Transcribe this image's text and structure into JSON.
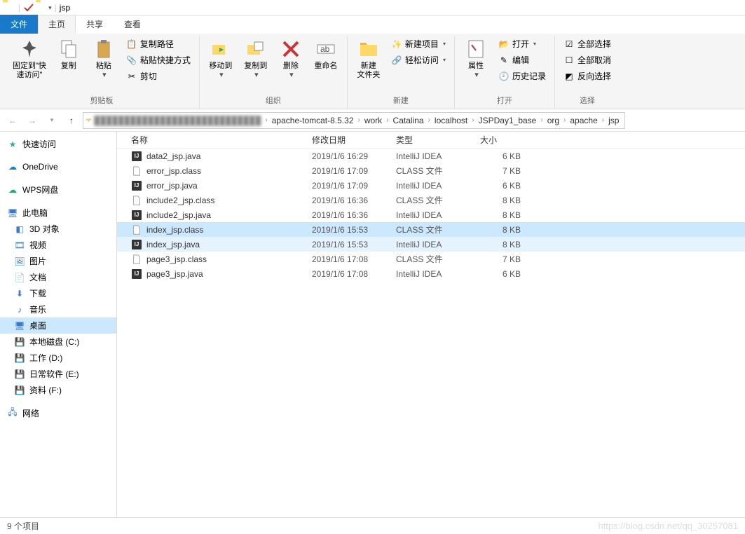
{
  "title": "jsp",
  "tabs": {
    "file": "文件",
    "home": "主页",
    "share": "共享",
    "view": "查看"
  },
  "ribbon": {
    "pin": "固定到\"快\n速访问\"",
    "copy": "复制",
    "paste": "粘贴",
    "cut": "剪切",
    "copypath": "复制路径",
    "pasteshortcut": "粘贴快捷方式",
    "group_clipboard": "剪贴板",
    "moveto": "移动到",
    "copyto": "复制到",
    "delete": "删除",
    "rename": "重命名",
    "group_organize": "组织",
    "newfolder": "新建\n文件夹",
    "newitem": "新建项目",
    "easyaccess": "轻松访问",
    "group_new": "新建",
    "properties": "属性",
    "open": "打开",
    "edit": "编辑",
    "history": "历史记录",
    "group_open": "打开",
    "selectall": "全部选择",
    "selectnone": "全部取消",
    "invertsel": "反向选择",
    "group_select": "选择"
  },
  "breadcrumbs": [
    "apache-tomcat-8.5.32",
    "work",
    "Catalina",
    "localhost",
    "JSPDay1_base",
    "org",
    "apache",
    "jsp"
  ],
  "columns": {
    "name": "名称",
    "date": "修改日期",
    "type": "类型",
    "size": "大小"
  },
  "sidebar": {
    "quick": "快速访问",
    "onedrive": "OneDrive",
    "wps": "WPS网盘",
    "thispc": "此电脑",
    "threed": "3D 对象",
    "videos": "视频",
    "pictures": "图片",
    "documents": "文档",
    "downloads": "下载",
    "music": "音乐",
    "desktop": "桌面",
    "localc": "本地磁盘 (C:)",
    "workd": "工作 (D:)",
    "dailye": "日常软件 (E:)",
    "dataf": "资料 (F:)",
    "network": "网络"
  },
  "files": [
    {
      "name": "data2_jsp.java",
      "date": "2019/1/6 16:29",
      "type": "IntelliJ IDEA",
      "size": "6 KB",
      "icon": "ij",
      "sel": ""
    },
    {
      "name": "error_jsp.class",
      "date": "2019/1/6 17:09",
      "type": "CLASS 文件",
      "size": "7 KB",
      "icon": "file",
      "sel": ""
    },
    {
      "name": "error_jsp.java",
      "date": "2019/1/6 17:09",
      "type": "IntelliJ IDEA",
      "size": "6 KB",
      "icon": "ij",
      "sel": ""
    },
    {
      "name": "include2_jsp.class",
      "date": "2019/1/6 16:36",
      "type": "CLASS 文件",
      "size": "8 KB",
      "icon": "file",
      "sel": ""
    },
    {
      "name": "include2_jsp.java",
      "date": "2019/1/6 16:36",
      "type": "IntelliJ IDEA",
      "size": "8 KB",
      "icon": "ij",
      "sel": ""
    },
    {
      "name": "index_jsp.class",
      "date": "2019/1/6 15:53",
      "type": "CLASS 文件",
      "size": "8 KB",
      "icon": "file",
      "sel": "sel"
    },
    {
      "name": "index_jsp.java",
      "date": "2019/1/6 15:53",
      "type": "IntelliJ IDEA",
      "size": "8 KB",
      "icon": "ij",
      "sel": "hov"
    },
    {
      "name": "page3_jsp.class",
      "date": "2019/1/6 17:08",
      "type": "CLASS 文件",
      "size": "7 KB",
      "icon": "file",
      "sel": ""
    },
    {
      "name": "page3_jsp.java",
      "date": "2019/1/6 17:08",
      "type": "IntelliJ IDEA",
      "size": "6 KB",
      "icon": "ij",
      "sel": ""
    }
  ],
  "status": "9 个项目",
  "watermark": "https://blog.csdn.net/qq_30257081"
}
